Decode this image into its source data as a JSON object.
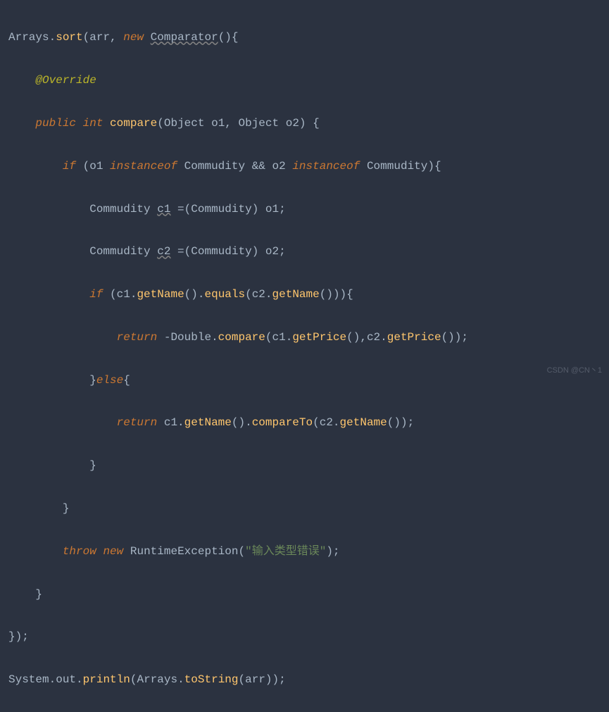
{
  "code": {
    "l1": {
      "cls": "Arrays",
      "dot": ".",
      "m": "sort",
      "o": "(",
      "arg1": "arr",
      "comma": ", ",
      "kw_new": "new",
      "sp": " ",
      "comp": "Comparator",
      "op2": "()",
      "ob": "{"
    },
    "l2": {
      "indent": "    ",
      "anno": "@Override"
    },
    "l3": {
      "indent": "    ",
      "kw_pub": "public",
      "sp": " ",
      "kw_int": "int",
      "sp2": " ",
      "m": "compare",
      "op": "(",
      "t1": "Object",
      "sp3": " ",
      "p1": "o1",
      "comma": ", ",
      "t2": "Object",
      "sp4": " ",
      "p2": "o2",
      "cp": ") ",
      "ob": "{"
    },
    "l4": {
      "indent": "        ",
      "kw_if": "if",
      "sp": " ",
      "op": "(",
      "p1": "o1",
      "sp2": " ",
      "kw_inst": "instanceof",
      "sp3": " ",
      "t1": "Commudity",
      "sp4": " && ",
      "p2": "o2",
      "sp5": " ",
      "kw_inst2": "instanceof",
      "sp6": " ",
      "t2": "Commudity",
      "cp": ")",
      "ob": "{"
    },
    "l5": {
      "indent": "            ",
      "t": "Commudity",
      "sp": " ",
      "v": "c1",
      "sp2": " =",
      "op": "(",
      "tc": "Commudity",
      "cp": ") ",
      "p": "o1",
      "sc": ";"
    },
    "l6": {
      "indent": "            ",
      "t": "Commudity",
      "sp": " ",
      "v": "c2",
      "sp2": " =",
      "op": "(",
      "tc": "Commudity",
      "cp": ") ",
      "p": "o2",
      "sc": ";"
    },
    "l7": {
      "indent": "            ",
      "kw_if": "if",
      "sp": " ",
      "op": "(",
      "v1": "c1",
      "dot": ".",
      "m1": "getName",
      "p1": "()",
      "dot2": ".",
      "m2": "equals",
      "op2": "(",
      "v2": "c2",
      "dot3": ".",
      "m3": "getName",
      "p3": "()",
      "cp": "))",
      "ob": "{"
    },
    "l8": {
      "indent": "                ",
      "kw_ret": "return",
      "sp": " ",
      "neg": "-",
      "cls": "Double",
      "dot": ".",
      "m": "compare",
      "op": "(",
      "v1": "c1",
      "dot2": ".",
      "m2": "getPrice",
      "p2": "()",
      "comma": ",",
      "v2": "c2",
      "dot3": ".",
      "m3": "getPrice",
      "p3": "()",
      "cp": ")",
      "sc": ";"
    },
    "l9": {
      "indent": "            ",
      "cb": "}",
      "kw_else": "else",
      "ob": "{"
    },
    "l10": {
      "indent": "                ",
      "kw_ret": "return",
      "sp": " ",
      "v1": "c1",
      "dot": ".",
      "m1": "getName",
      "p1": "()",
      "dot2": ".",
      "m2": "compareTo",
      "op": "(",
      "v2": "c2",
      "dot3": ".",
      "m3": "getName",
      "p3": "()",
      "cp": ")",
      "sc": ";"
    },
    "l11": {
      "indent": "            ",
      "cb": "}"
    },
    "l12": {
      "indent": "        ",
      "cb": "}"
    },
    "l13": {
      "indent": "        ",
      "kw_throw": "throw",
      "sp": " ",
      "kw_new": "new",
      "sp2": " ",
      "cls": "RuntimeException",
      "op": "(",
      "str": "\"输入类型错误\"",
      "cp": ")",
      "sc": ";"
    },
    "l14": {
      "indent": "    ",
      "cb": "}"
    },
    "l15": {
      "cb": "});"
    },
    "l16": {
      "cls": "System",
      "dot": ".",
      "f": "out",
      "dot2": ".",
      "m": "println",
      "op": "(",
      "cls2": "Arrays",
      "dot3": ".",
      "m2": "toString",
      "op2": "(",
      "arg": "arr",
      "cp": "))",
      "sc": ";"
    }
  },
  "watermark": "CSDN @CN丶1"
}
